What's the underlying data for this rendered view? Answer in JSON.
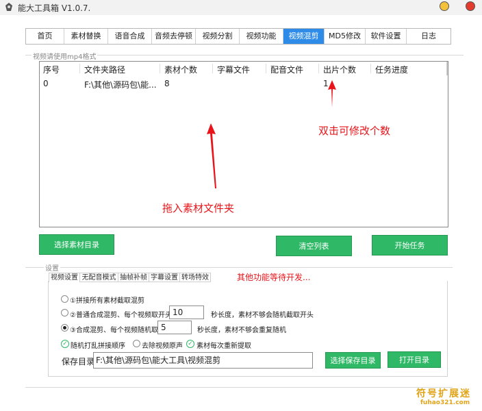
{
  "window": {
    "title": "能大工具箱 V1.0.7."
  },
  "tabs": [
    {
      "label": "首页"
    },
    {
      "label": "素材替换"
    },
    {
      "label": "语音合成"
    },
    {
      "label": "音频去停顿"
    },
    {
      "label": "视频分割"
    },
    {
      "label": "视频功能"
    },
    {
      "label": "视频混剪",
      "active": true
    },
    {
      "label": "MD5修改"
    },
    {
      "label": "软件设置"
    },
    {
      "label": "日志"
    }
  ],
  "upload_group": {
    "legend": "视频请使用mp4格式"
  },
  "table": {
    "columns": [
      "序号",
      "文件夹路径",
      "素材个数",
      "字幕文件",
      "配音文件",
      "出片个数",
      "任务进度"
    ],
    "rows": [
      {
        "index": "0",
        "path": "F:\\其他\\源码包\\能...",
        "material_count": "8",
        "subtitle": "",
        "dubbing": "",
        "output_count": "1",
        "progress": ""
      }
    ]
  },
  "annotations": {
    "double_click": "双击可修改个数",
    "drag_in": "拖入素材文件夹",
    "more_features": "其他功能等待开发..."
  },
  "buttons": {
    "select_material": "选择素材目录",
    "clear_list": "清空列表",
    "start_task": "开始任务",
    "select_save": "选择保存目录",
    "open_dir": "打开目录"
  },
  "settings": {
    "legend": "设置",
    "subtabs": [
      "视频设置",
      "无配音模式",
      "抽帧补帧",
      "字幕设置",
      "转场特效"
    ],
    "options": {
      "opt1": "①拼接所有素材截取混剪",
      "opt2": "②普通合成混剪、每个视频取开头",
      "opt2_value": "10",
      "opt2_suffix": "秒长度，素材不够会随机截取开头",
      "opt3": "③合成混剪、每个视频随机取",
      "opt3_value": "5",
      "opt3_suffix": "秒长度，素材不够会重复随机"
    },
    "checks": {
      "shuffle": "随机打乱拼接顺序",
      "remove_audio": "去除视频原声",
      "re_extract": "素材每次重新提取"
    },
    "save_dir": {
      "label": "保存目录",
      "value": "F:\\其他\\源码包\\能大工具\\视频混剪"
    }
  },
  "watermark": {
    "text": "符号扩展迷",
    "url": "fuhao321.com"
  },
  "colors": {
    "accent": "#2e8ce8",
    "button_green": "#2fb866",
    "annotation_red": "#e8141a"
  }
}
